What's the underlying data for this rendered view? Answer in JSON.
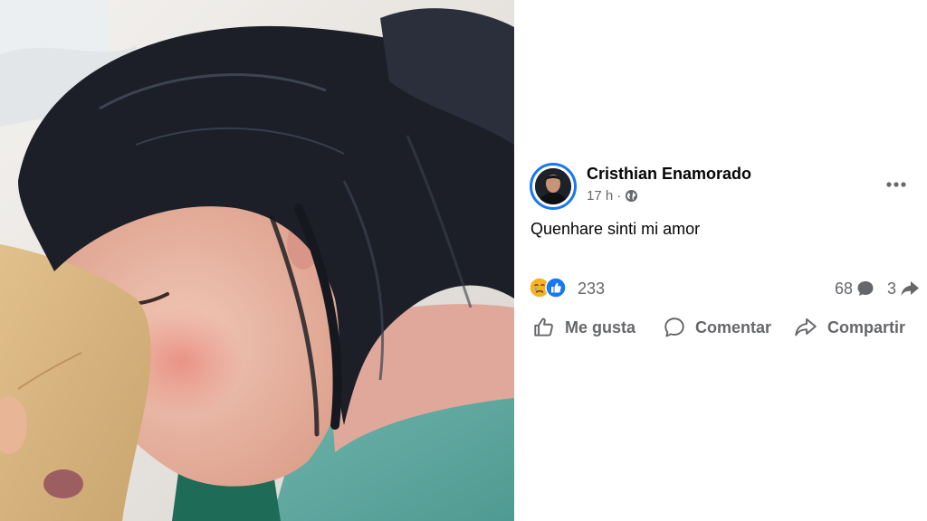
{
  "post": {
    "author": "Cristhian Enamorado",
    "time": "17 h",
    "separator": "·",
    "privacy_icon": "globe-icon",
    "caption": "Quenhare sinti mi amor",
    "reactions": {
      "icons": [
        "crying-face-icon",
        "thumbs-up-icon"
      ],
      "count": "233"
    },
    "comments_count": "68",
    "shares_count": "3",
    "actions": {
      "like_label": "Me gusta",
      "comment_label": "Comentar",
      "share_label": "Compartir"
    },
    "more_icon": "more-options-icon"
  },
  "colors": {
    "brand_blue": "#1877f2",
    "text_primary": "#050505",
    "text_secondary": "#65676b"
  }
}
